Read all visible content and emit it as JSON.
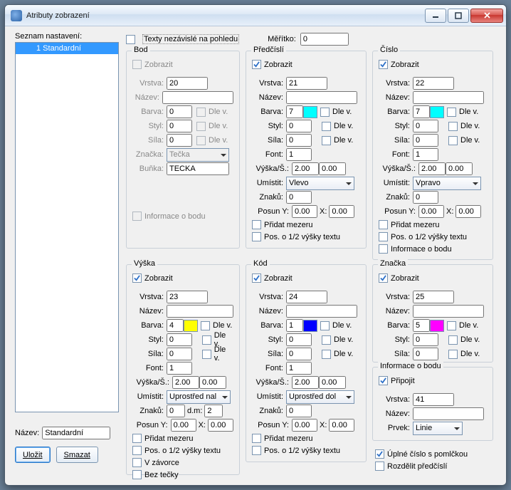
{
  "window": {
    "title": "Atributy zobrazení"
  },
  "left": {
    "list_label": "Seznam nastavení:",
    "list_items": [
      "1 Standardní"
    ],
    "name_label": "Název:",
    "name_value": "Standardní",
    "save": "Uložit",
    "delete": "Smazat"
  },
  "top": {
    "texts_independent": "Texty nezávislé na pohledu",
    "scale_label": "Měřítko:",
    "scale_value": "0"
  },
  "labels": {
    "zobrazit": "Zobrazit",
    "vrstva": "Vrstva:",
    "nazev": "Název:",
    "barva": "Barva:",
    "styl": "Styl:",
    "sila": "Síla:",
    "font": "Font:",
    "znacka_f": "Značka:",
    "bunka": "Buňka:",
    "vyskas": "Výška/Š.:",
    "umistit": "Umístit:",
    "znaku": "Znaků:",
    "posuny": "Posun Y:",
    "x": "X:",
    "dm": "d.m:",
    "dlev": "Dle v.",
    "pridat_mezeru": "Přidat mezeru",
    "pos_half": "Pos. o 1/2 výšky textu",
    "info_bodu": "Informace o bodu",
    "v_zavorce": "V závorce",
    "bez_tecky": "Bez tečky",
    "pripojit": "Připojit",
    "prvek": "Prvek:",
    "uplne_cislo": "Úplné číslo s pomlčkou",
    "rozdelit": "Rozdělit předčíslí"
  },
  "bod": {
    "title": "Bod",
    "vrstva": "20",
    "nazev": "",
    "barva": "0",
    "styl": "0",
    "sila": "0",
    "znacka": "Tečka",
    "bunka": "TECKA"
  },
  "predcisli": {
    "title": "Předčíslí",
    "vrstva": "21",
    "nazev": "",
    "barva": "7",
    "styl": "0",
    "sila": "0",
    "font": "1",
    "vyska": "2.00",
    "sirka": "0.00",
    "umistit": "Vlevo",
    "znaku": "0",
    "posuny": "0.00",
    "posunx": "0.00",
    "swatch": "#00ffff"
  },
  "cislo": {
    "title": "Číslo",
    "vrstva": "22",
    "nazev": "",
    "barva": "7",
    "styl": "0",
    "sila": "0",
    "font": "1",
    "vyska": "2.00",
    "sirka": "0.00",
    "umistit": "Vpravo",
    "znaku": "0",
    "posuny": "0.00",
    "posunx": "0.00",
    "swatch": "#00ffff"
  },
  "vyska": {
    "title": "Výška",
    "vrstva": "23",
    "nazev": "",
    "barva": "4",
    "styl": "0",
    "sila": "0",
    "font": "1",
    "vyska": "2.00",
    "sirka": "0.00",
    "umistit": "Uprostřed nal",
    "znaku": "0",
    "dm": "2",
    "posuny": "0.00",
    "posunx": "0.00",
    "swatch": "#ffff00"
  },
  "kod": {
    "title": "Kód",
    "vrstva": "24",
    "nazev": "",
    "barva": "1",
    "styl": "0",
    "sila": "0",
    "font": "1",
    "vyska": "2.00",
    "sirka": "0.00",
    "umistit": "Uprostřed dol",
    "znaku": "0",
    "posuny": "0.00",
    "posunx": "0.00",
    "swatch": "#0000ff"
  },
  "znacka": {
    "title": "Značka",
    "vrstva": "25",
    "nazev": "",
    "barva": "5",
    "styl": "0",
    "sila": "0",
    "swatch": "#ff00ff"
  },
  "info": {
    "title": "Informace o bodu",
    "vrstva": "41",
    "nazev": "",
    "prvek": "Linie"
  }
}
